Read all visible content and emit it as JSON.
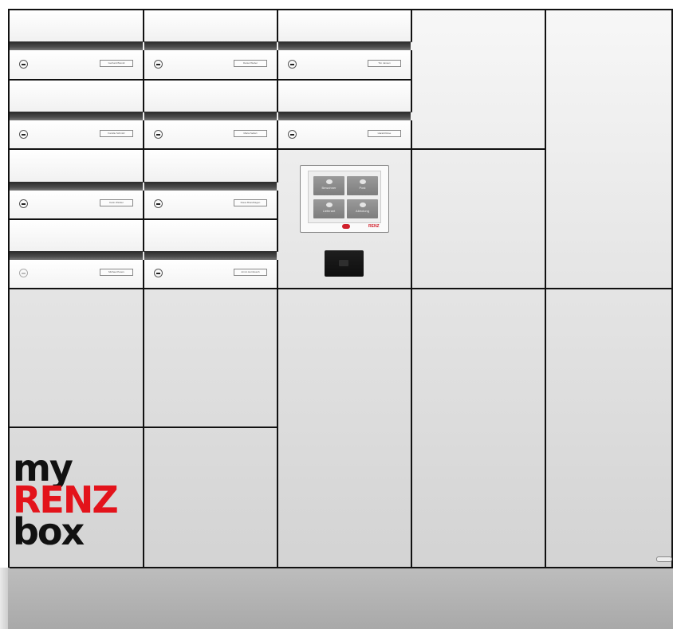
{
  "mailboxes": [
    {
      "name": "Gerhard Brandt",
      "lock_dim": false
    },
    {
      "name": "Daniel Weber",
      "lock_dim": false
    },
    {
      "name": "Tim Jansen",
      "lock_dim": false
    },
    {
      "name": "Familie Schmitz",
      "lock_dim": false
    },
    {
      "name": "Maria Seifert",
      "lock_dim": false
    },
    {
      "name": "Harald Rose",
      "lock_dim": false
    },
    {
      "name": "Karin Winkler",
      "lock_dim": false
    },
    {
      "name": "Klaus Brandhagen",
      "lock_dim": false
    },
    {
      "name": "Michael Peters",
      "lock_dim": true
    },
    {
      "name": "Armin Hornbusch",
      "lock_dim": false
    }
  ],
  "terminal": {
    "tiles": [
      "Bewohner",
      "Post",
      "Lieferant",
      "Abholung"
    ],
    "brand": "RENZ"
  },
  "logo": {
    "line1": "my",
    "line2": "RENZ",
    "line3": "box"
  },
  "colors": {
    "brand_red": "#e3131b",
    "frame": "#111111"
  }
}
